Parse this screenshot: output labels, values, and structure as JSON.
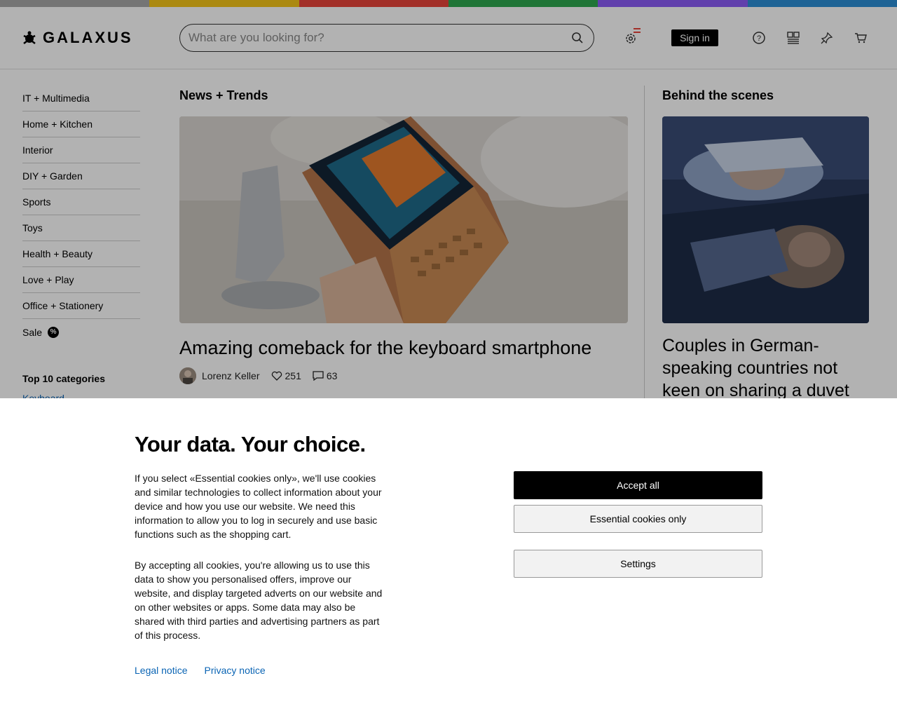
{
  "stripe_colors": [
    "#e5e5e5",
    "#ffe31a",
    "#ff4040",
    "#31c48d",
    "#8b5cf6",
    "#1e9bf0"
  ],
  "header": {
    "logo_text": "GALAXUS",
    "search_placeholder": "What are you looking for?",
    "sign_in_label": "Sign in"
  },
  "sidebar": {
    "items": [
      {
        "label": "IT + Multimedia"
      },
      {
        "label": "Home + Kitchen"
      },
      {
        "label": "Interior"
      },
      {
        "label": "DIY + Garden"
      },
      {
        "label": "Sports"
      },
      {
        "label": "Toys"
      },
      {
        "label": "Health + Beauty"
      },
      {
        "label": "Love + Play"
      },
      {
        "label": "Office + Stationery"
      }
    ],
    "sale_label": "Sale",
    "sale_badge": "%",
    "top10_title": "Top 10 categories",
    "top10_first": "Keyboard"
  },
  "main": {
    "news_title": "News + Trends",
    "news_headline": "Amazing comeback for the keyboard smartphone",
    "author": "Lorenz Keller",
    "likes": "251",
    "comments": "63",
    "behind_title": "Behind the scenes",
    "behind_headline": "Couples in German-speaking countries not keen on sharing a duvet"
  },
  "cookie": {
    "title": "Your data. Your choice.",
    "para1": "If you select «Essential cookies only», we'll use cookies and similar technologies to collect information about your device and how you use our website. We need this information to allow you to log in securely and use basic functions such as the shopping cart.",
    "para2": "By accepting all cookies, you're allowing us to use this data to show you personalised offers, improve our website, and display targeted adverts on our website and on other websites or apps. Some data may also be shared with third parties and advertising partners as part of this process.",
    "legal_notice": "Legal notice",
    "privacy_notice": "Privacy notice",
    "accept_all": "Accept all",
    "essential_only": "Essential cookies only",
    "settings": "Settings"
  }
}
